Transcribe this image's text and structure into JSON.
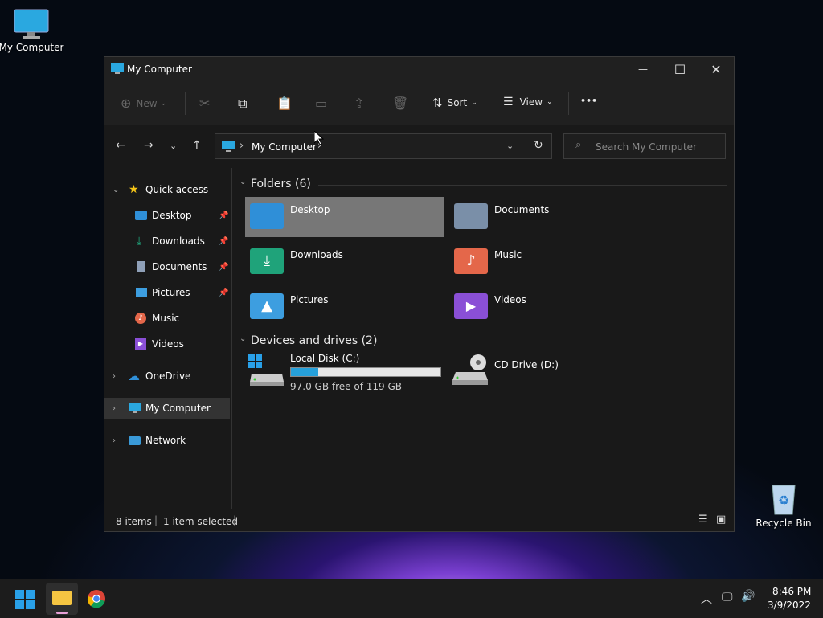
{
  "desktop": {
    "icons": [
      {
        "label": "My Computer",
        "icon": "monitor-icon"
      },
      {
        "label": "Recycle Bin",
        "icon": "recycle-bin-icon"
      }
    ]
  },
  "window": {
    "title": "My Computer",
    "controls": {
      "minimize": "—",
      "maximize": "☐",
      "close": "✕"
    }
  },
  "commandbar": {
    "new_label": "New",
    "sort_label": "Sort",
    "view_label": "View",
    "more_label": "•••"
  },
  "address": {
    "path": "My Computer",
    "separator": "›",
    "search_placeholder": "Search My Computer"
  },
  "sidebar": {
    "quick_access": "Quick access",
    "items": [
      {
        "label": "Desktop",
        "pinned": true
      },
      {
        "label": "Downloads",
        "pinned": true
      },
      {
        "label": "Documents",
        "pinned": true
      },
      {
        "label": "Pictures",
        "pinned": true
      },
      {
        "label": "Music",
        "pinned": false
      },
      {
        "label": "Videos",
        "pinned": false
      }
    ],
    "onedrive": "OneDrive",
    "my_computer": "My Computer",
    "network": "Network"
  },
  "content": {
    "folders_header": "Folders (6)",
    "folders": [
      {
        "label": "Desktop",
        "color": "#2f8fd8"
      },
      {
        "label": "Documents",
        "color": "#7a8fa8"
      },
      {
        "label": "Downloads",
        "color": "#1fa37a"
      },
      {
        "label": "Music",
        "color": "#e4674a"
      },
      {
        "label": "Pictures",
        "color": "#3d9ee0"
      },
      {
        "label": "Videos",
        "color": "#8a4fd6"
      }
    ],
    "drives_header": "Devices and drives (2)",
    "drives": [
      {
        "label": "Local Disk (C:)",
        "free_text": "97.0 GB free of 119 GB",
        "used_fraction": 0.185
      },
      {
        "label": "CD Drive (D:)"
      }
    ]
  },
  "status": {
    "items": "8 items",
    "selected": "1 item selected"
  },
  "taskbar": {
    "time": "8:46 PM",
    "date": "3/9/2022"
  }
}
